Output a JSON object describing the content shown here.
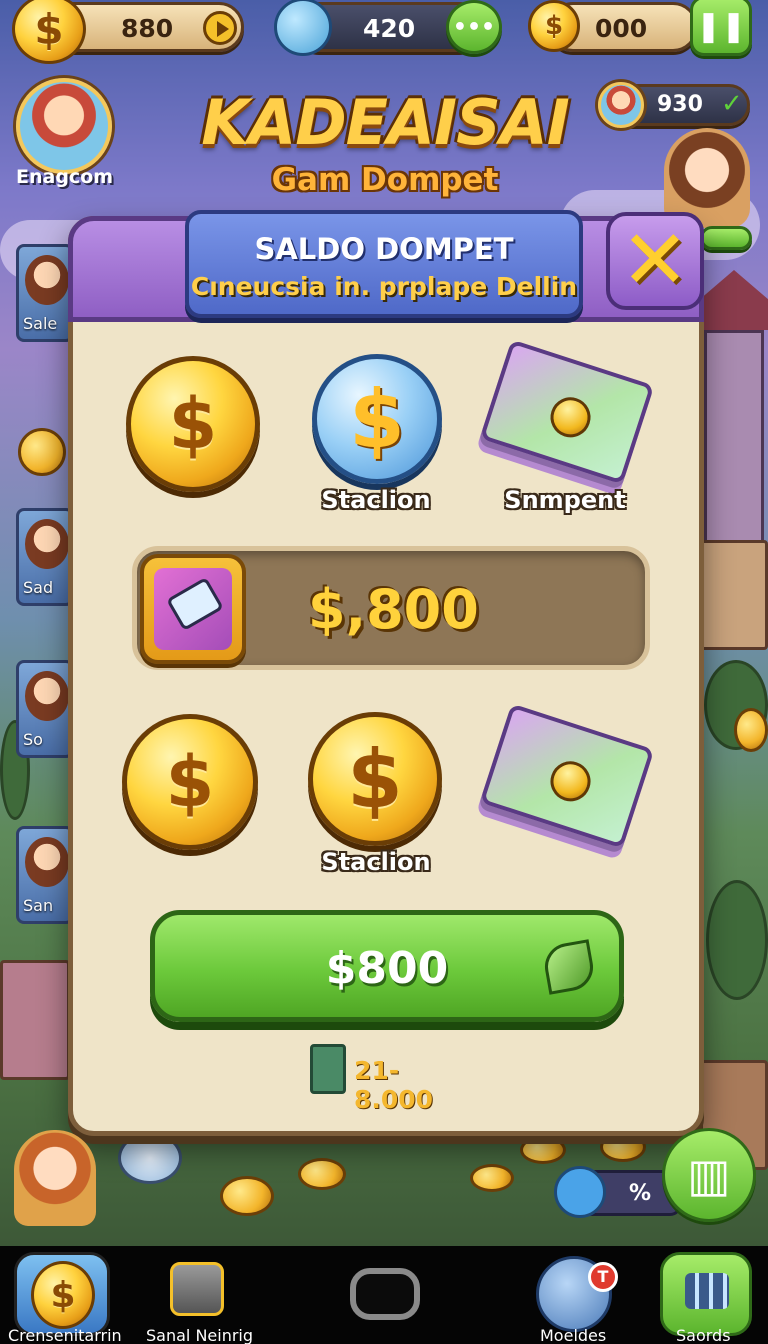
{
  "top_bar": {
    "coins": "880",
    "gems": "420",
    "wallet": "000"
  },
  "profile": {
    "name": "Enagcom",
    "small_counter": "930"
  },
  "game": {
    "title": "KADEAISAI",
    "subtitle": "Gam Dompet"
  },
  "side_cards": [
    "Sale",
    "Sad",
    "So",
    "San"
  ],
  "dialog": {
    "heading": "SALDO DOMPET",
    "subheading": "Cıneucsia in. prplape Dellin",
    "row1": [
      {
        "kind": "gold-coin",
        "label": ""
      },
      {
        "kind": "blue-coin",
        "label": "Staclion"
      },
      {
        "kind": "cards",
        "label": "Snmpent"
      }
    ],
    "balance": "$,800",
    "row2": [
      {
        "kind": "gold-coin",
        "label": ""
      },
      {
        "kind": "gold-coin",
        "label": "Staclion"
      },
      {
        "kind": "cards",
        "label": ""
      }
    ],
    "buy_button": "$800",
    "footnote": "21-8.000"
  },
  "floating_widget": {
    "percent": "%"
  },
  "bottom_nav": [
    {
      "label": "Crensenitarrin"
    },
    {
      "label": "Sanal Neinrig"
    },
    {
      "label": "Moeldes",
      "badge": "T"
    },
    {
      "label": "Saords"
    }
  ]
}
